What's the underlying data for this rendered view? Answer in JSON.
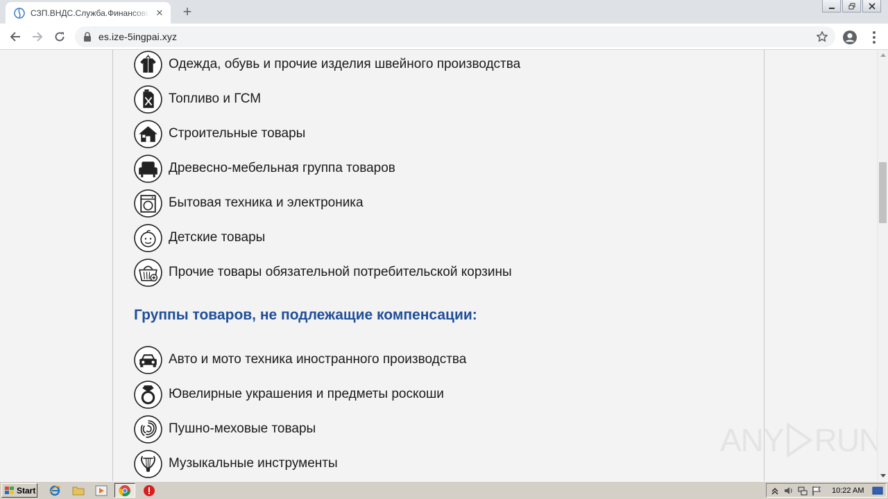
{
  "browser": {
    "tab": {
      "title": "СЗП.ВНДС.Служба.Финансовой.Защиты"
    },
    "address_bar": {
      "url": "es.ize-5ingpai.xyz"
    }
  },
  "page": {
    "taxable_items": [
      {
        "icon": "clothing-icon",
        "label": "Одежда, обувь и прочие изделия швейного производства"
      },
      {
        "icon": "fuel-canister-icon",
        "label": "Топливо и ГСМ"
      },
      {
        "icon": "house-icon",
        "label": "Строительные товары"
      },
      {
        "icon": "armchair-icon",
        "label": "Древесно-мебельная группа товаров"
      },
      {
        "icon": "washing-machine-icon",
        "label": "Бытовая техника и электроника"
      },
      {
        "icon": "baby-face-icon",
        "label": "Детские товары"
      },
      {
        "icon": "basket-icon",
        "label": "Прочие товары обязательной потребительской корзины"
      }
    ],
    "non_compensable_heading": "Группы товаров, не подлежащие компенсации:",
    "non_compensable_items": [
      {
        "icon": "car-icon",
        "label": "Авто и мото техника иностранного производства"
      },
      {
        "icon": "ring-icon",
        "label": "Ювелирные украшения и предметы роскоши"
      },
      {
        "icon": "fur-icon",
        "label": "Пушно-меховые товары"
      },
      {
        "icon": "lyre-icon",
        "label": "Музыкальные инструменты"
      }
    ]
  },
  "watermark": {
    "text_left": "ANY",
    "text_right": "RUN"
  },
  "taskbar": {
    "start_label": "Start",
    "clock": "10:22 AM"
  },
  "colors": {
    "heading": "#1f4e9a",
    "text": "#1a1a1a",
    "page_bg": "#f3f3f3"
  }
}
